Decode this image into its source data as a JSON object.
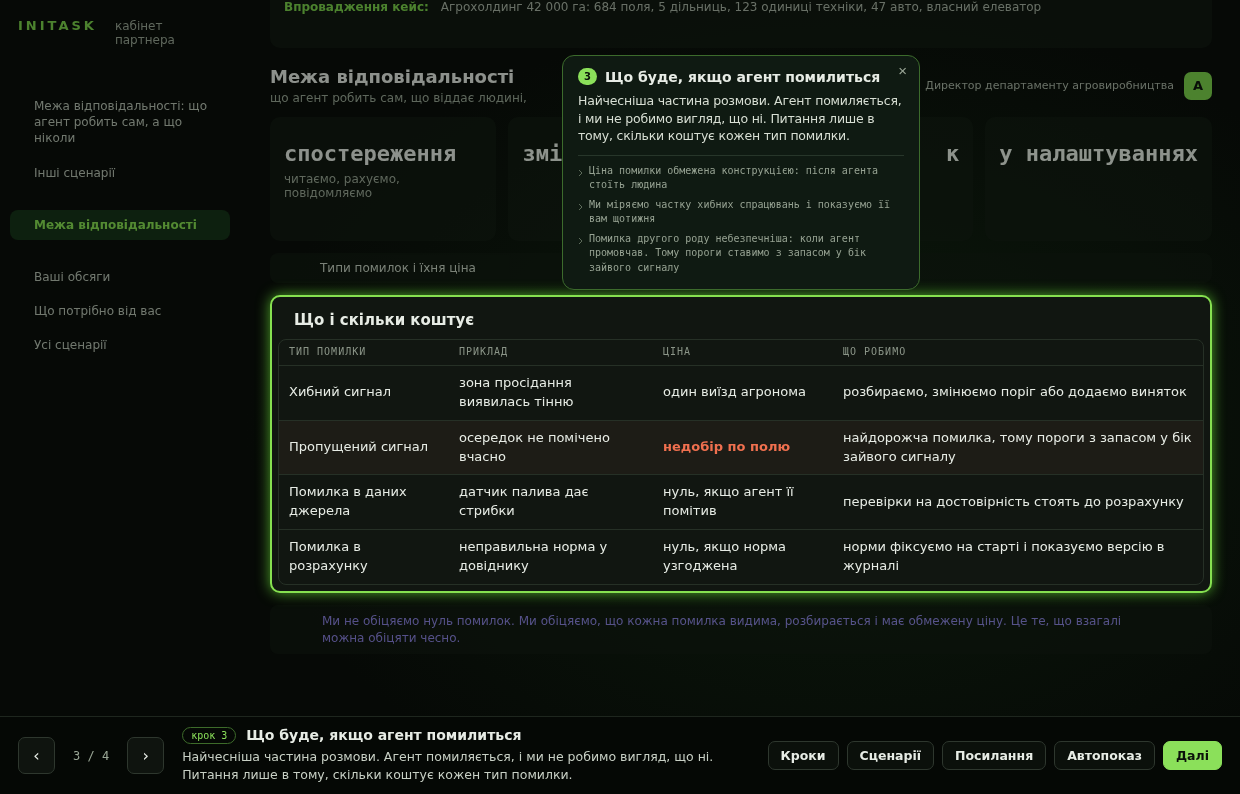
{
  "sidebar": {
    "logo": "INITASK",
    "subtitle": "кабінет партнера",
    "items": [
      {
        "label": "Межа відповідальності: що агент робить сам, а що ніколи",
        "selected": false
      },
      {
        "label": "Інші сценарії",
        "selected": false
      },
      {
        "label": "Межа відповідальності",
        "selected": true
      },
      {
        "label": "Ваші обсяги",
        "selected": false
      },
      {
        "label": "Що потрібно від вас",
        "selected": false
      },
      {
        "label": "Усі сценарії",
        "selected": false
      }
    ]
  },
  "case_strip": {
    "label": "Впровадження кейс:",
    "text": "Агрохолдинг 42 000 га: 684 поля, 5 дільниць, 123 одиниці техніки, 47 авто, власний елеватор"
  },
  "header": {
    "title": "Межа відповідальності",
    "subtitle": "що агент робить сам, що віддає людині,",
    "role": "Директор департаменту агровиробництва",
    "avatar": "А"
  },
  "cards": [
    {
      "title": "спостереження",
      "text": "читаємо, рахуємо, повідомляємо"
    },
    {
      "title": "змі"
    },
    {
      "title": "к"
    },
    {
      "title": "у налаштуваннях"
    }
  ],
  "section_bar": {
    "title": "Типи помилок і їхня ціна"
  },
  "table_card": {
    "title": "Що і скільки коштує",
    "columns": [
      "ТИП ПОМИЛКИ",
      "ПРИКЛАД",
      "ЦІНА",
      "ЩО РОБИМО"
    ],
    "rows": [
      {
        "cells": [
          "Хибний сигнал",
          "зона просідання виявилась тінню",
          "один виїзд агронома",
          "розбираємо, змінюємо поріг або додаємо виняток"
        ],
        "highlighted": false
      },
      {
        "cells": [
          "Пропущений сигнал",
          "осередок не помічено вчасно",
          "недобір по полю",
          "найдорожча помилка, тому пороги з запасом у бік зайвого сигналу"
        ],
        "highlighted": true
      },
      {
        "cells": [
          "Помилка в даних джерела",
          "датчик палива дає стрибки",
          "нуль, якщо агент її помітив",
          "перевірки на достовірність стоять до розрахунку"
        ],
        "highlighted": false
      },
      {
        "cells": [
          "Помилка в розрахунку",
          "неправильна норма у довіднику",
          "нуль, якщо норма узгоджена",
          "норми фіксуємо на старті і показуємо версію в журналі"
        ],
        "highlighted": false
      }
    ]
  },
  "note": "Ми не обіцяємо нуль помилок. Ми обіцяємо, що кожна помилка видима, розбирається і має обмежену ціну. Це те, що взагалі можна обіцяти чесно.",
  "tooltip": {
    "step": "3",
    "title": "Що буде, якщо агент помилиться",
    "close": "×",
    "body": "Найчесніша частина розмови. Агент помиляється, і ми не робимо вигляд, що ні. Питання лише в тому, скільки коштує кожен тип помилки.",
    "bullets": [
      "Ціна помилки обмежена конструкцією: після агента стоїть людина",
      "Ми міряємо частку хибних спрацювань і показуємо її вам щотижня",
      "Помилка другого роду небезпечніша: коли агент промовчав. Тому пороги ставимо з запасом у бік зайвого сигналу"
    ]
  },
  "bottom_bar": {
    "prev": "‹",
    "counter": "3 / 4",
    "next": "›",
    "badge": "крок 3",
    "title": "Що буде, якщо агент помилиться",
    "text": "Найчесніша частина розмови. Агент помиляється, і ми не робимо вигляд, що ні. Питання лише в тому, скільки коштує кожен тип помилки.",
    "buttons": [
      {
        "label": "Кроки",
        "kind": "secondary"
      },
      {
        "label": "Сценарії",
        "kind": "secondary"
      },
      {
        "label": "Посилання",
        "kind": "secondary"
      },
      {
        "label": "Автопоказ",
        "kind": "secondary"
      },
      {
        "label": "Далі",
        "kind": "primary"
      }
    ]
  }
}
